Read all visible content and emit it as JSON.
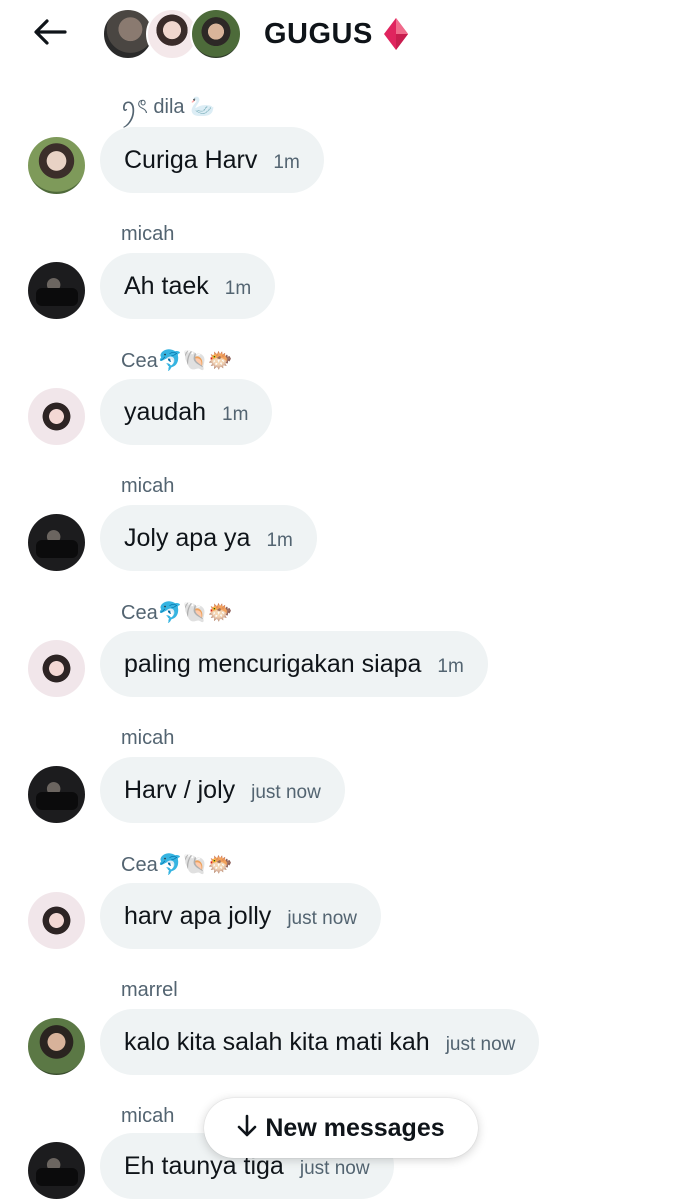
{
  "header": {
    "title": "GUGUS",
    "back_icon": "arrow-left-icon",
    "title_icon": "red-diamond-icon"
  },
  "messages": [
    {
      "sender": "ꪆৎ dila 🦢",
      "text": "Curiga Harv",
      "time": "1m",
      "avatar": "dila"
    },
    {
      "sender": "micah",
      "text": "Ah taek",
      "time": "1m",
      "avatar": "micah"
    },
    {
      "sender": "Cea🐬🐚🐡",
      "text": "yaudah",
      "time": "1m",
      "avatar": "cea"
    },
    {
      "sender": "micah",
      "text": "Joly apa ya",
      "time": "1m",
      "avatar": "micah"
    },
    {
      "sender": "Cea🐬🐚🐡",
      "text": "paling mencurigakan siapa",
      "time": "1m",
      "avatar": "cea"
    },
    {
      "sender": "micah",
      "text": "Harv / joly",
      "time": "just now",
      "avatar": "micah"
    },
    {
      "sender": "Cea🐬🐚🐡",
      "text": "harv apa jolly",
      "time": "just now",
      "avatar": "cea"
    },
    {
      "sender": "marrel",
      "text": "kalo kita salah kita mati kah",
      "time": "just now",
      "avatar": "marrel"
    },
    {
      "sender": "micah",
      "text": "Eh taunya tiga",
      "time": "just now",
      "avatar": "micah"
    }
  ],
  "new_messages": {
    "label": "New messages",
    "icon": "arrow-down-icon"
  },
  "colors": {
    "bubble": "#eff3f4",
    "secondary_text": "#536471",
    "primary_text": "#0f1419",
    "diamond": "#e0245e"
  }
}
